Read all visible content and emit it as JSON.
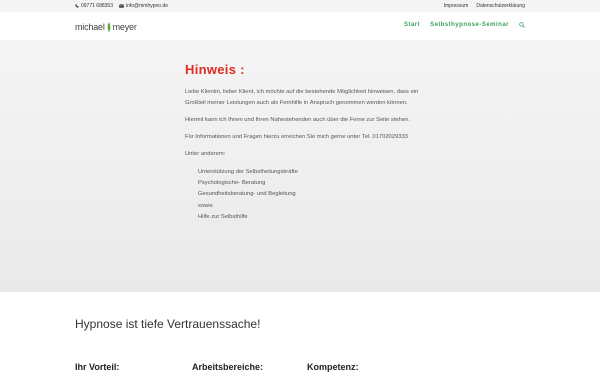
{
  "topbar": {
    "phone": "09771 688353",
    "email": "info@mmhypno.de",
    "links": [
      "Impressum",
      "Datenschutzerklärung"
    ]
  },
  "header": {
    "logo": {
      "part1": "michael",
      "part2": "meyer"
    },
    "nav": [
      "Start",
      "Selbsthypnose-Seminar"
    ],
    "accent_color": "#3aa25e"
  },
  "notice": {
    "title": "Hinweis :",
    "title_color": "#e02b20",
    "paragraphs": [
      "Liebe Klientin, lieber Klient, ich möchte auf die bestehende Möglichkeit hinweisen, dass ein Großteil meiner Leistungen auch als Fernhilfe in Anspruch genommen werden können.",
      "Hiermit kann ich Ihnen und Ihren Nahestehenden auch über die Ferne zur Seite stehen.",
      "Für Informationen und Fragen hierzu erreichen Sie mich gerne unter Tel. 01702029333",
      "Unter anderem:"
    ],
    "list": [
      "Unterstützung der Selbstheilungskräfte",
      "Psychologische- Beratung",
      "Gesundheitsberatung- und Begleitung",
      "sowie",
      "Hilfe zur Selbsthilfe"
    ]
  },
  "section": {
    "headline": "Hypnose ist tiefe Vertrauenssache!",
    "columns": [
      "Ihr Vorteil:",
      "Arbeitsbereiche:",
      "Kompetenz:"
    ]
  }
}
